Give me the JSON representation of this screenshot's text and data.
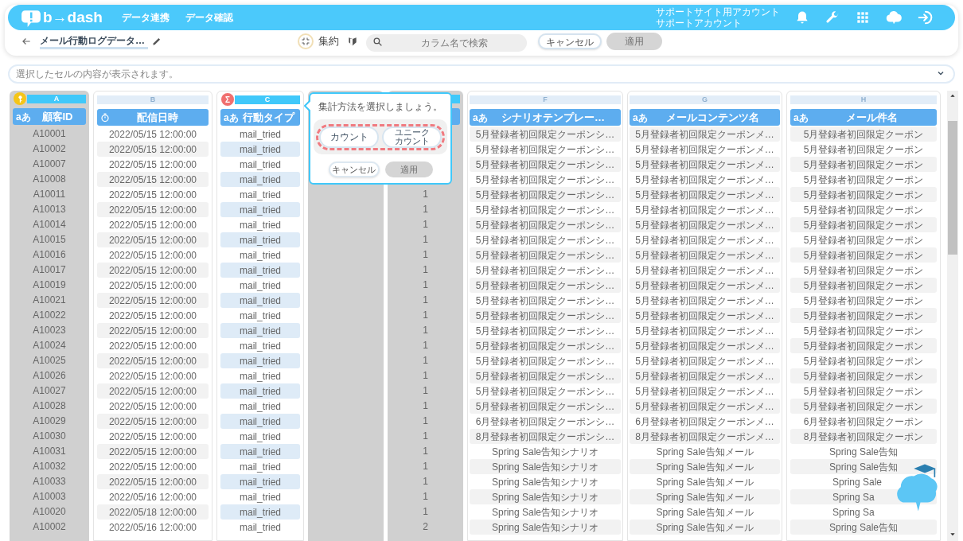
{
  "header": {
    "logo": "b→dash",
    "nav": [
      {
        "label": "データ連携"
      },
      {
        "label": "データ確認"
      }
    ],
    "account": [
      "サポートサイト用アカウント",
      "サポートアカウント"
    ]
  },
  "toolbar": {
    "title": "メール行動ログデータ…",
    "aggregate_label": "集約",
    "search": {
      "placeholder": "カラム名で検索"
    },
    "cancel": "キャンセル",
    "apply": {
      "label": "適用",
      "disabled": true
    }
  },
  "cell_viewer": {
    "placeholder": "選択したセルの内容が表示されます。"
  },
  "columns": [
    {
      "letter": "A",
      "name": "顧客ID",
      "kind": "text",
      "type_label": "aあ",
      "badge": {
        "kind": "key"
      },
      "dimmed": true,
      "active": true,
      "stripes": false,
      "cells": [
        "A10001",
        "A10002",
        "A10007",
        "A10008",
        "A10011",
        "A10013",
        "A10014",
        "A10015",
        "A10016",
        "A10017",
        "A10019",
        "A10021",
        "A10022",
        "A10023",
        "A10024",
        "A10025",
        "A10026",
        "A10027",
        "A10028",
        "A10029",
        "A10030",
        "A10031",
        "A10032",
        "A10033",
        "A10003",
        "A10020",
        "A10002"
      ]
    },
    {
      "letter": "B",
      "name": "配信日時",
      "kind": "datetime",
      "dimmed": false,
      "active": false,
      "stripes": true,
      "stripe_first_row": false,
      "blue_stripes": false,
      "cells": [
        "2022/05/15 12:00:00",
        "2022/05/15 12:00:00",
        "2022/05/15 12:00:00",
        "2022/05/15 12:00:00",
        "2022/05/15 12:00:00",
        "2022/05/15 12:00:00",
        "2022/05/15 12:00:00",
        "2022/05/15 12:00:00",
        "2022/05/15 12:00:00",
        "2022/05/15 12:00:00",
        "2022/05/15 12:00:00",
        "2022/05/15 12:00:00",
        "2022/05/15 12:00:00",
        "2022/05/15 12:00:00",
        "2022/05/15 12:00:00",
        "2022/05/15 12:00:00",
        "2022/05/15 12:00:00",
        "2022/05/15 12:00:00",
        "2022/05/15 12:00:00",
        "2022/05/15 12:00:00",
        "2022/05/15 12:00:00",
        "2022/05/15 12:00:00",
        "2022/05/15 12:00:00",
        "2022/05/15 12:00:00",
        "2022/05/16 12:00:00",
        "2022/05/18 12:00:00",
        "2022/05/16 12:00:00"
      ]
    },
    {
      "letter": "C",
      "name": "行動タイプ",
      "kind": "text",
      "type_label": "aあ",
      "badge": {
        "kind": "sum",
        "symbol": "Σ"
      },
      "dimmed": false,
      "active": true,
      "stripes": true,
      "stripe_first_row": false,
      "blue_stripes": true,
      "cells": [
        "mail_tried",
        "mail_tried",
        "mail_tried",
        "mail_tried",
        "mail_tried",
        "mail_tried",
        "mail_tried",
        "mail_tried",
        "mail_tried",
        "mail_tried",
        "mail_tried",
        "mail_tried",
        "mail_tried",
        "mail_tried",
        "mail_tried",
        "mail_tried",
        "mail_tried",
        "mail_tried",
        "mail_tried",
        "mail_tried",
        "mail_tried",
        "mail_tried",
        "mail_tried",
        "mail_tried",
        "mail_tried",
        "mail_tried",
        "mail_tried"
      ]
    },
    {
      "dimmed": true
    },
    {
      "dimmed": true,
      "active": true,
      "cells": [
        null,
        null,
        null,
        null,
        "1",
        "1",
        "1",
        "1",
        "1",
        "1",
        "1",
        "1",
        "1",
        "1",
        "1",
        "1",
        "1",
        "1",
        "1",
        "1",
        "1",
        "1",
        "1",
        "1",
        "1",
        "1",
        "2"
      ]
    },
    {
      "letter": "F",
      "name": "シナリオテンプレー…",
      "kind": "text",
      "type_label": "aあ",
      "dimmed": false,
      "active": false,
      "stripes": true,
      "stripe_first_row": true,
      "blue_stripes": false,
      "cells": [
        "5月登録者初回限定クーポンシ…",
        "5月登録者初回限定クーポンシ…",
        "5月登録者初回限定クーポンシ…",
        "5月登録者初回限定クーポンシ…",
        "5月登録者初回限定クーポンシ…",
        "5月登録者初回限定クーポンシ…",
        "5月登録者初回限定クーポンシ…",
        "5月登録者初回限定クーポンシ…",
        "5月登録者初回限定クーポンシ…",
        "5月登録者初回限定クーポンシ…",
        "5月登録者初回限定クーポンシ…",
        "5月登録者初回限定クーポンシ…",
        "5月登録者初回限定クーポンシ…",
        "5月登録者初回限定クーポンシ…",
        "5月登録者初回限定クーポンシ…",
        "5月登録者初回限定クーポンシ…",
        "5月登録者初回限定クーポンシ…",
        "5月登録者初回限定クーポンシ…",
        "5月登録者初回限定クーポンシ…",
        "6月登録者初回限定クーポンシ…",
        "8月登録者初回限定クーポンシ…",
        "Spring Sale告知シナリオ",
        "Spring Sale告知シナリオ",
        "Spring Sale告知シナリオ",
        "Spring Sale告知シナリオ",
        "Spring Sale告知シナリオ",
        "Spring Sale告知シナリオ"
      ]
    },
    {
      "letter": "G",
      "name": "メールコンテンツ名",
      "kind": "text",
      "type_label": "aあ",
      "dimmed": false,
      "active": false,
      "stripes": true,
      "stripe_first_row": true,
      "blue_stripes": false,
      "cells": [
        "5月登録者初回限定クーポンメ…",
        "5月登録者初回限定クーポンメ…",
        "5月登録者初回限定クーポンメ…",
        "5月登録者初回限定クーポンメ…",
        "5月登録者初回限定クーポンメ…",
        "5月登録者初回限定クーポンメ…",
        "5月登録者初回限定クーポンメ…",
        "5月登録者初回限定クーポンメ…",
        "5月登録者初回限定クーポンメ…",
        "5月登録者初回限定クーポンメ…",
        "5月登録者初回限定クーポンメ…",
        "5月登録者初回限定クーポンメ…",
        "5月登録者初回限定クーポンメ…",
        "5月登録者初回限定クーポンメ…",
        "5月登録者初回限定クーポンメ…",
        "5月登録者初回限定クーポンメ…",
        "5月登録者初回限定クーポンメ…",
        "5月登録者初回限定クーポンメ…",
        "5月登録者初回限定クーポンメ…",
        "6月登録者初回限定クーポンメ…",
        "8月登録者初回限定クーポンメ…",
        "Spring Sale告知メール",
        "Spring Sale告知メール",
        "Spring Sale告知メール",
        "Spring Sale告知メール",
        "Spring Sale告知メール",
        "Spring Sale告知メール"
      ]
    },
    {
      "letter": "H",
      "name": "メール件名",
      "kind": "text",
      "type_label": "aあ",
      "dimmed": false,
      "active": false,
      "stripes": true,
      "stripe_first_row": true,
      "blue_stripes": false,
      "cells": [
        "5月登録者初回限定クーポン",
        "5月登録者初回限定クーポン",
        "5月登録者初回限定クーポン",
        "5月登録者初回限定クーポン",
        "5月登録者初回限定クーポン",
        "5月登録者初回限定クーポン",
        "5月登録者初回限定クーポン",
        "5月登録者初回限定クーポン",
        "5月登録者初回限定クーポン",
        "5月登録者初回限定クーポン",
        "5月登録者初回限定クーポン",
        "5月登録者初回限定クーポン",
        "5月登録者初回限定クーポン",
        "5月登録者初回限定クーポン",
        "5月登録者初回限定クーポン",
        "5月登録者初回限定クーポン",
        "5月登録者初回限定クーポン",
        "5月登録者初回限定クーポン",
        "5月登録者初回限定クーポン",
        "6月登録者初回限定クーポン",
        "8月登録者初回限定クーポン",
        "Spring Sale告知",
        "Spring Sale告知",
        {
          "text": "Spring Sale",
          "partial": true
        },
        {
          "text": "Spring Sa",
          "partial": true
        },
        {
          "text": "Spring Sa",
          "partial": true
        },
        "Spring Sale告知"
      ]
    }
  ],
  "popover": {
    "title": "集計方法を選択しましょう。",
    "options": [
      {
        "lines": [
          "カウント"
        ],
        "selected": false
      },
      {
        "lines": [
          "ユニーク",
          "カウント"
        ],
        "selected": false
      }
    ],
    "cancel": "キャンセル",
    "apply": {
      "label": "適用",
      "disabled": true
    }
  }
}
